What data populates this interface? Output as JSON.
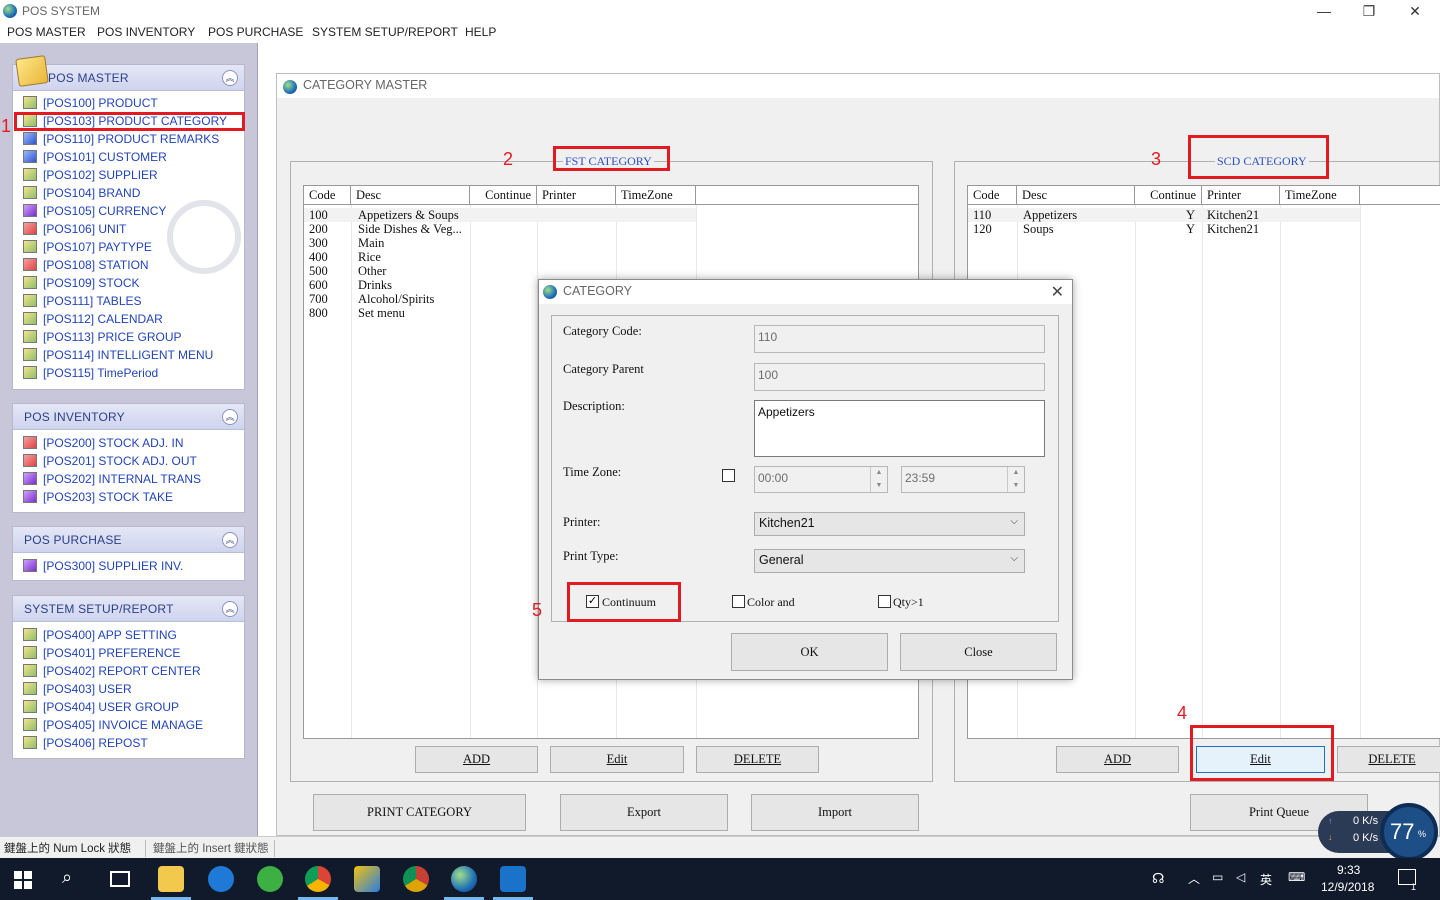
{
  "window": {
    "title": "POS SYSTEM"
  },
  "menu": [
    "POS MASTER",
    "POS INVENTORY",
    "POS PURCHASE",
    "SYSTEM SETUP/REPORT",
    "HELP"
  ],
  "nav": {
    "pos_master": {
      "title": "POS MASTER",
      "items": [
        "[POS100] PRODUCT",
        "[POS103] PRODUCT CATEGORY",
        "[POS110] PRODUCT REMARKS",
        "[POS101] CUSTOMER",
        "[POS102] SUPPLIER",
        "[POS104] BRAND",
        "[POS105] CURRENCY",
        "[POS106] UNIT",
        "[POS107] PAYTYPE",
        "[POS108] STATION",
        "[POS109] STOCK",
        "[POS111] TABLES",
        "[POS112] CALENDAR",
        "[POS113] PRICE GROUP",
        "[POS114] INTELLIGENT MENU",
        "[POS115] TimePeriod"
      ]
    },
    "pos_inventory": {
      "title": "POS INVENTORY",
      "items": [
        "[POS200] STOCK ADJ. IN",
        "[POS201] STOCK ADJ. OUT",
        "[POS202] INTERNAL TRANS",
        "[POS203] STOCK TAKE"
      ]
    },
    "pos_purchase": {
      "title": "POS PURCHASE",
      "items": [
        "[POS300] SUPPLIER INV."
      ]
    },
    "system_setup": {
      "title": "SYSTEM SETUP/REPORT",
      "items": [
        "[POS400] APP SETTING",
        "[POS401] PREFERENCE",
        "[POS402] REPORT CENTER",
        "[POS403] USER",
        "[POS404] USER GROUP",
        "[POS405] INVOICE MANAGE",
        "[POS406] REPOST"
      ]
    }
  },
  "status": {
    "numlock": "鍵盤上的 Num Lock 狀態",
    "insert": "鍵盤上的 Insert 鍵狀態"
  },
  "category_master": {
    "title": "CATEGORY MASTER",
    "fst": {
      "legend": "FST CATEGORY",
      "columns": [
        "Code",
        "Desc",
        "Continue",
        "Printer",
        "TimeZone"
      ],
      "rows": [
        {
          "code": "100",
          "desc": "Appetizers & Soups"
        },
        {
          "code": "200",
          "desc": "Side Dishes & Veg..."
        },
        {
          "code": "300",
          "desc": "Main"
        },
        {
          "code": "400",
          "desc": "Rice"
        },
        {
          "code": "500",
          "desc": "Other"
        },
        {
          "code": "600",
          "desc": "Drinks"
        },
        {
          "code": "700",
          "desc": "Alcohol/Spirits"
        },
        {
          "code": "800",
          "desc": "Set menu"
        }
      ],
      "buttons": {
        "add": "ADD",
        "edit": "Edit",
        "delete": "DELETE"
      }
    },
    "scd": {
      "legend": "SCD CATEGORY",
      "columns": [
        "Code",
        "Desc",
        "Continue",
        "Printer",
        "TimeZone"
      ],
      "rows": [
        {
          "code": "110",
          "desc": "Appetizers",
          "continue": "Y",
          "printer": "Kitchen21"
        },
        {
          "code": "120",
          "desc": "Soups",
          "continue": "Y",
          "printer": "Kitchen21"
        }
      ],
      "buttons": {
        "add": "ADD",
        "edit": "Edit",
        "delete": "DELETE"
      }
    },
    "bottom_buttons": {
      "print_category": "PRINT CATEGORY",
      "export": "Export",
      "import": "Import",
      "print_queue": "Print Queue"
    }
  },
  "dialog": {
    "title": "CATEGORY",
    "labels": {
      "code": "Category Code:",
      "parent": "Category Parent",
      "desc": "Description:",
      "timezone": "Time Zone:",
      "printer": "Printer:",
      "print_type": "Print Type:"
    },
    "values": {
      "code": "110",
      "parent": "100",
      "desc": "Appetizers",
      "tz_from": "00:00",
      "tz_to": "23:59",
      "printer": "Kitchen21",
      "print_type": "General"
    },
    "checkboxes": {
      "continuum": "Continuum",
      "color": "Color and",
      "qty": "Qty>1"
    },
    "continuum_checked": true,
    "buttons": {
      "ok": "OK",
      "close": "Close"
    }
  },
  "annotations": [
    "1",
    "2",
    "3",
    "4",
    "5"
  ],
  "netwidget": {
    "up": "0 K/s",
    "down": "0 K/s",
    "percent": "77",
    "unit": "%"
  },
  "clock": {
    "time": "9:33",
    "date": "12/9/2018"
  },
  "tray": {
    "ime": "英",
    "notifications": "1"
  }
}
